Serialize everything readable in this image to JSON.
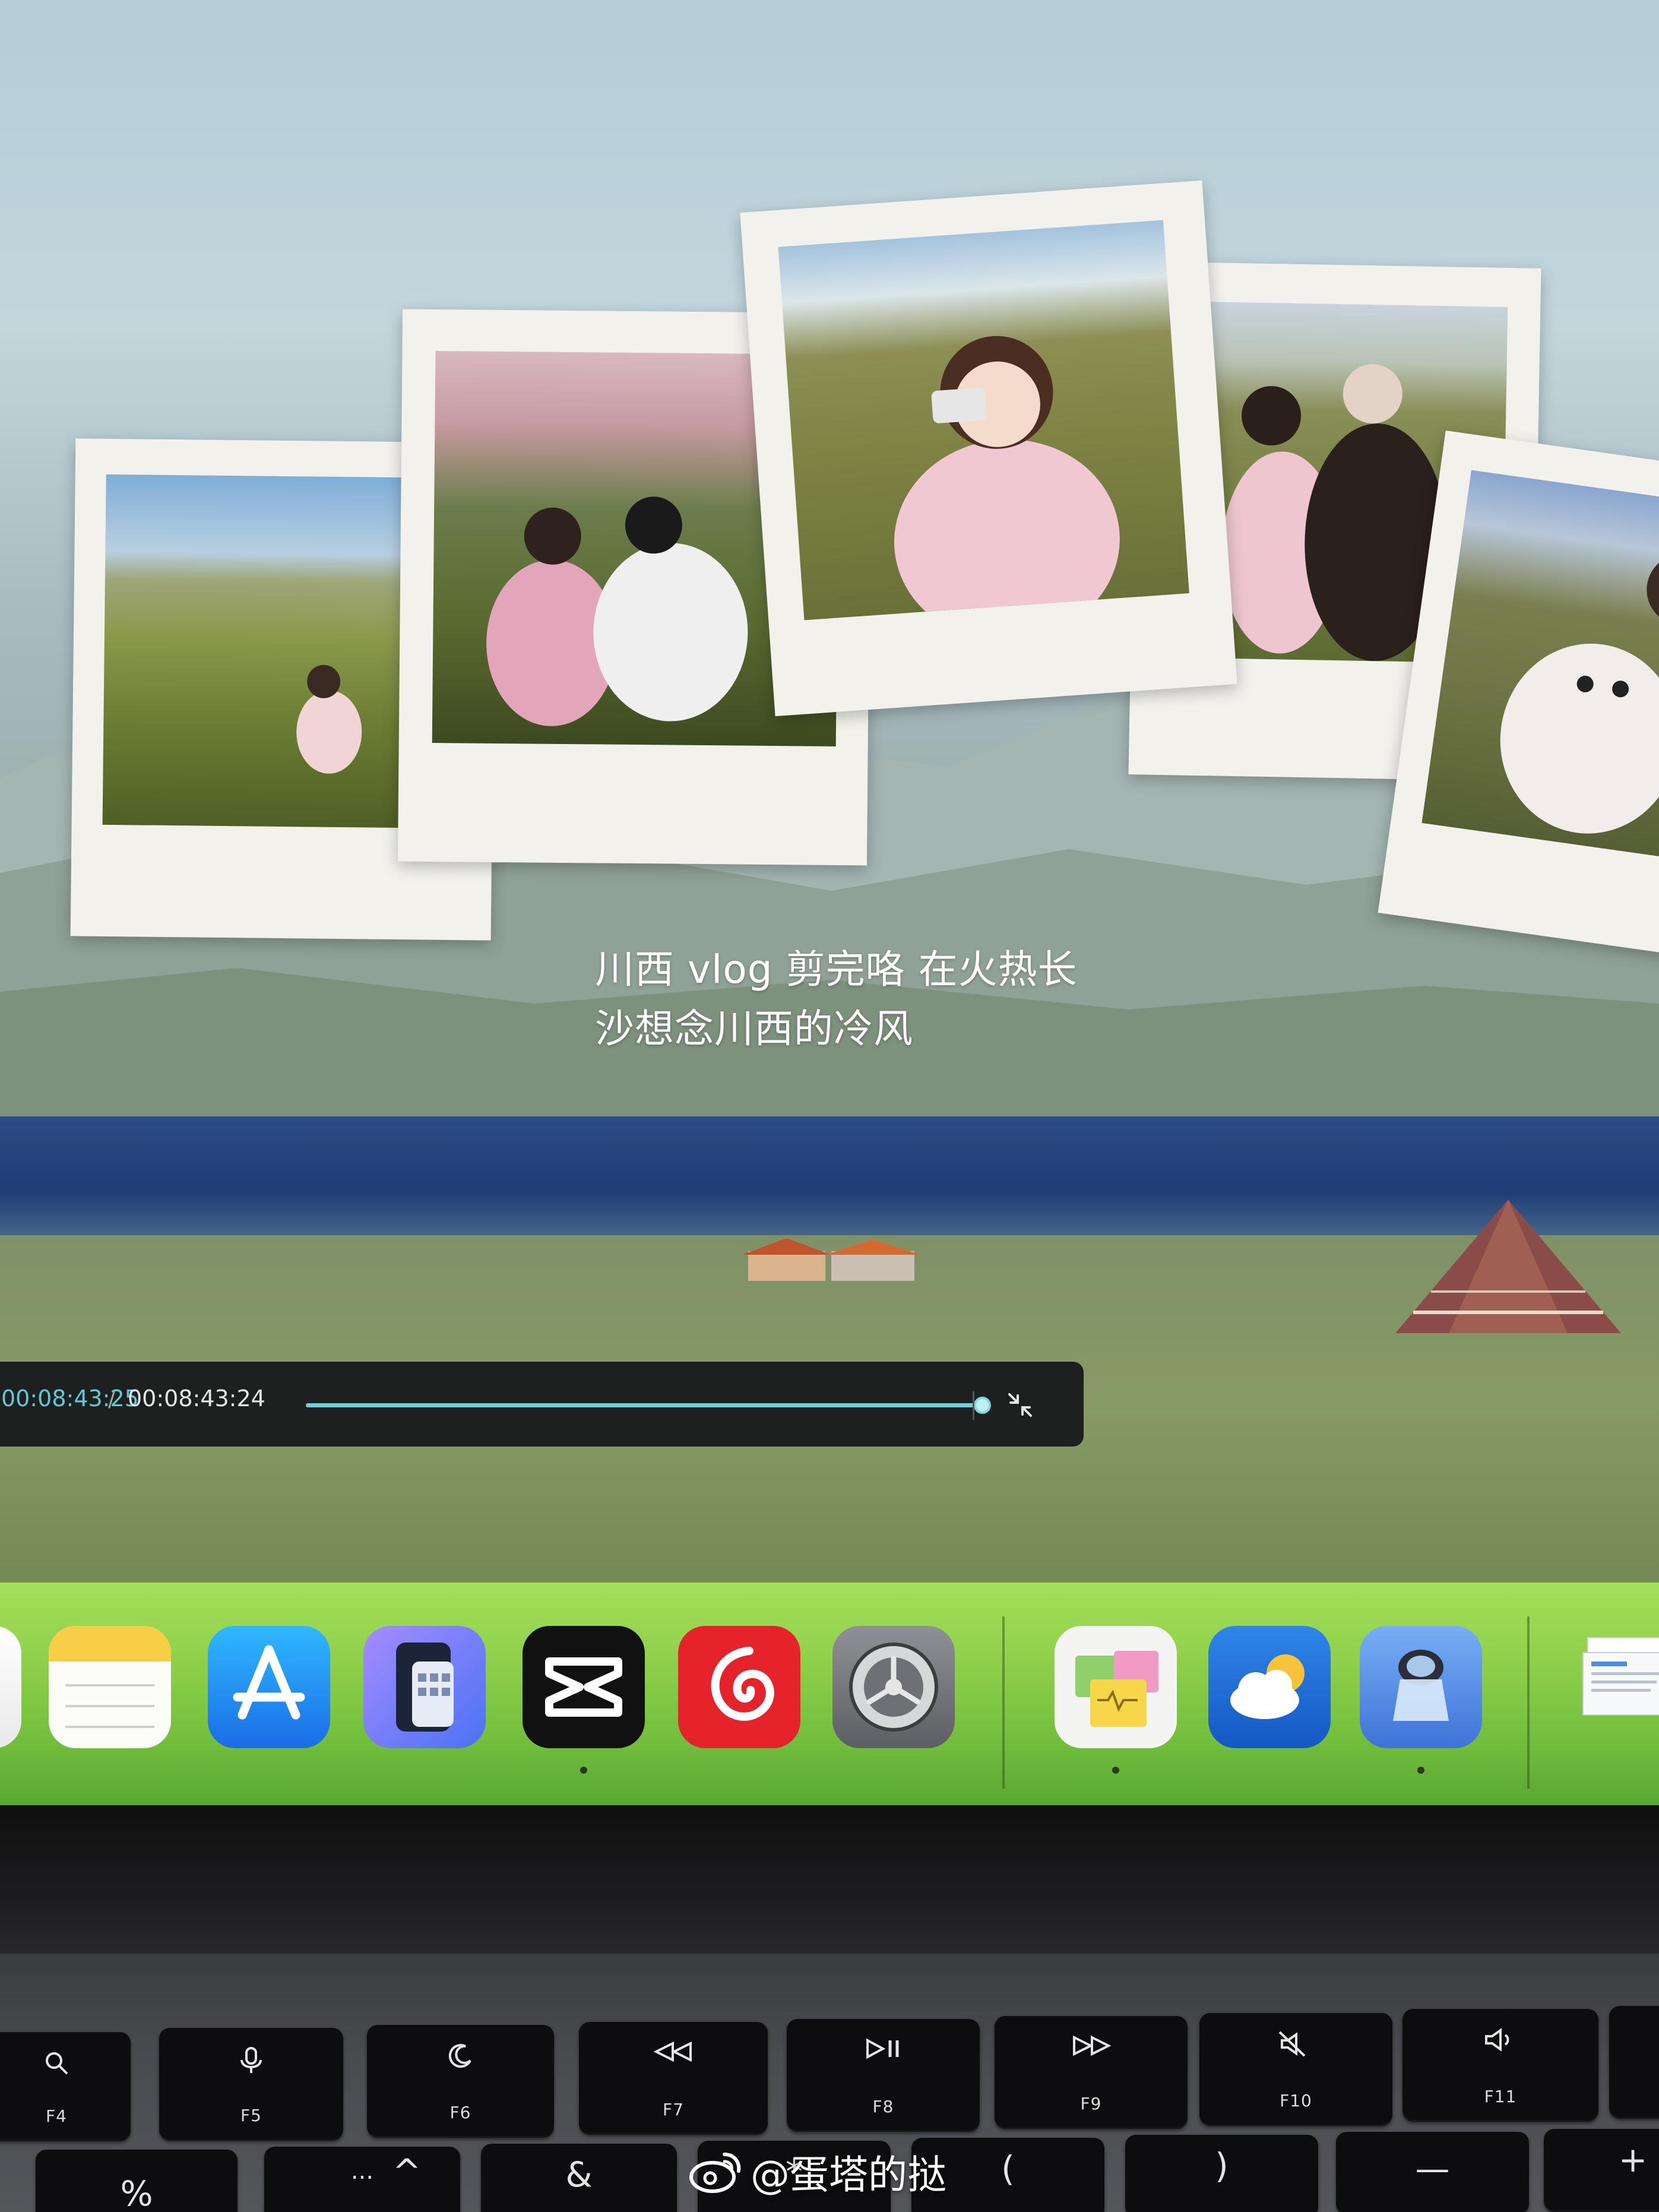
{
  "video": {
    "caption_line1": "川西 vlog 剪完咯 在火热长",
    "caption_line2": "沙想念川西的冷风"
  },
  "player": {
    "current_time": "00:08:43:25",
    "separator": "/",
    "total_time": "00:08:43:24",
    "progress": 0.99,
    "accent_color": "#6fd0d8"
  },
  "dock": {
    "items": [
      {
        "name": "notes-app",
        "icon": "notes-icon",
        "running": false
      },
      {
        "name": "app-store",
        "icon": "app-store-icon",
        "running": false
      },
      {
        "name": "simulator",
        "icon": "device-simulator-icon",
        "running": false
      },
      {
        "name": "capcut",
        "icon": "capcut-icon",
        "running": true
      },
      {
        "name": "netease-cloud-music",
        "icon": "netease-music-icon",
        "running": false
      },
      {
        "name": "system-settings",
        "icon": "gear-icon",
        "running": false
      },
      {
        "name": "stickies",
        "icon": "stickies-icon",
        "running": true
      },
      {
        "name": "weather",
        "icon": "weather-icon",
        "running": false
      },
      {
        "name": "preview",
        "icon": "magnifier-icon",
        "running": true
      },
      {
        "name": "document-stack",
        "icon": "documents-icon",
        "running": false
      }
    ],
    "background_color": "#8fd04a"
  },
  "keyboard": {
    "function_row": [
      {
        "label": "F4",
        "icon": "search-icon"
      },
      {
        "label": "F5",
        "icon": "microphone-icon"
      },
      {
        "label": "F6",
        "icon": "moon-icon"
      },
      {
        "label": "F7",
        "icon": "rewind-icon"
      },
      {
        "label": "F8",
        "icon": "play-pause-icon"
      },
      {
        "label": "F9",
        "icon": "fast-forward-icon"
      },
      {
        "label": "F10",
        "icon": "mute-icon"
      },
      {
        "label": "F11",
        "icon": "volume-down-icon"
      }
    ],
    "number_row": [
      "%",
      "...",
      "^",
      "&",
      "*",
      "(",
      ")",
      "—",
      "+"
    ]
  },
  "watermark": {
    "handle": "@蛋塔的挞",
    "icon": "weibo-icon"
  }
}
